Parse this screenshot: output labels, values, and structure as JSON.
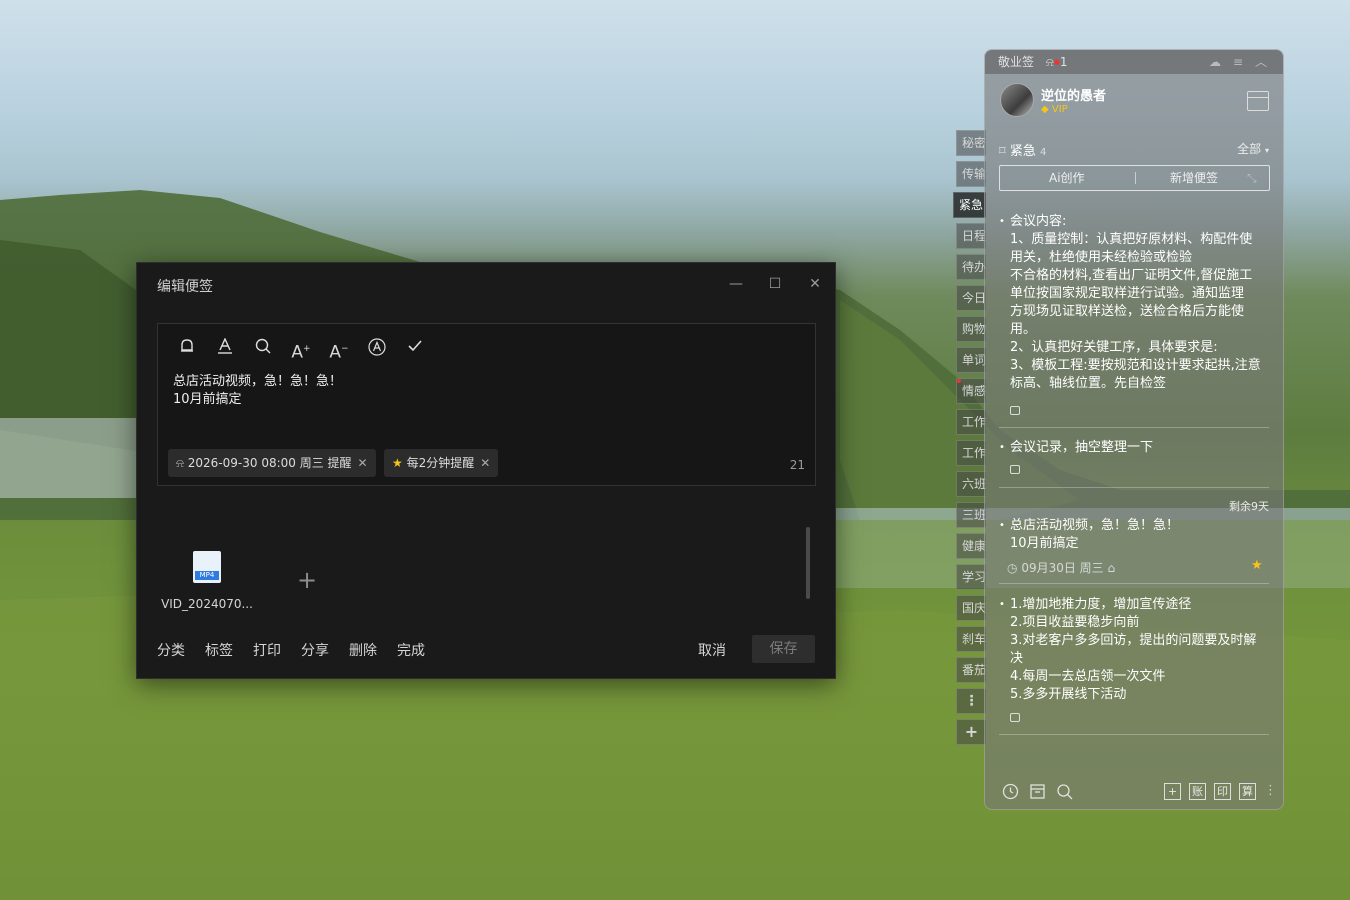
{
  "editor": {
    "title": "编辑便签",
    "controls": {
      "minimize": "—",
      "maximize": "☐",
      "close": "✕"
    },
    "toolbar_icons": [
      "bell-icon",
      "text-color-icon",
      "search-icon",
      "font-increase-icon",
      "font-decrease-icon",
      "auto-format-icon",
      "check-icon"
    ],
    "note_lines": [
      "总店活动视频，急！急！急！",
      "10月前搞定"
    ],
    "reminder_chip": "2026-09-30 08:00 周三 提醒",
    "repeat_chip": "每2分钟提醒",
    "char_count": "21",
    "attachment": {
      "badge": "MP4",
      "name": "VID_2024070..."
    },
    "add_attachment": "+",
    "bottom_actions": [
      "分类",
      "标签",
      "打印",
      "分享",
      "删除",
      "完成"
    ],
    "cancel_label": "取消",
    "save_label": "保存"
  },
  "side_tabs": [
    "秘密",
    "传输",
    "紧急",
    "日程",
    "待办",
    "今日",
    "购物",
    "单词",
    "情感",
    "工作",
    "工作",
    "六班",
    "三班",
    "健康",
    "学习",
    "国庆",
    "刹车",
    "番茄"
  ],
  "side_controls": {
    "more": "⋮",
    "add": "+"
  },
  "panel": {
    "app_name": "敬业签",
    "notif_count": "1",
    "user": {
      "name": "逆位的愚者",
      "vip": "VIP"
    },
    "category": {
      "name": "紧急",
      "count": "4"
    },
    "filter_all": "全部",
    "ai_label": "Ai创作",
    "new_label": "新增便签",
    "notes": [
      {
        "lines": [
          "会议内容:",
          "1、质量控制：认真把好原材料、构配件使",
          "用关，杜绝使用未经检验或检验",
          "不合格的材料,查看出厂证明文件,督促施工",
          "单位按国家规定取样进行试验。通知监理",
          "方现场见证取样送检，送检合格后方能使",
          "用。",
          "2、认真把好关键工序，具体要求是:",
          "3、模板工程:要按规范和设计要求起拱,注意",
          "标高、轴线位置。先自检签"
        ]
      },
      {
        "lines": [
          "会议记录，抽空整理一下"
        ]
      },
      {
        "remaining": "剩余9天",
        "lines": [
          "总店活动视频，急！急！急！",
          "10月前搞定"
        ],
        "date": "09月30日 周三"
      },
      {
        "lines": [
          "1.增加地推力度，增加宣传途径",
          "2.项目收益要稳步向前",
          "3.对老客户多多回访，提出的问题要及时解",
          "决",
          "4.每周一去总店领一次文件",
          "5.多多开展线下活动"
        ]
      }
    ],
    "footer_boxes": [
      "+",
      "账",
      "印",
      "算"
    ]
  }
}
